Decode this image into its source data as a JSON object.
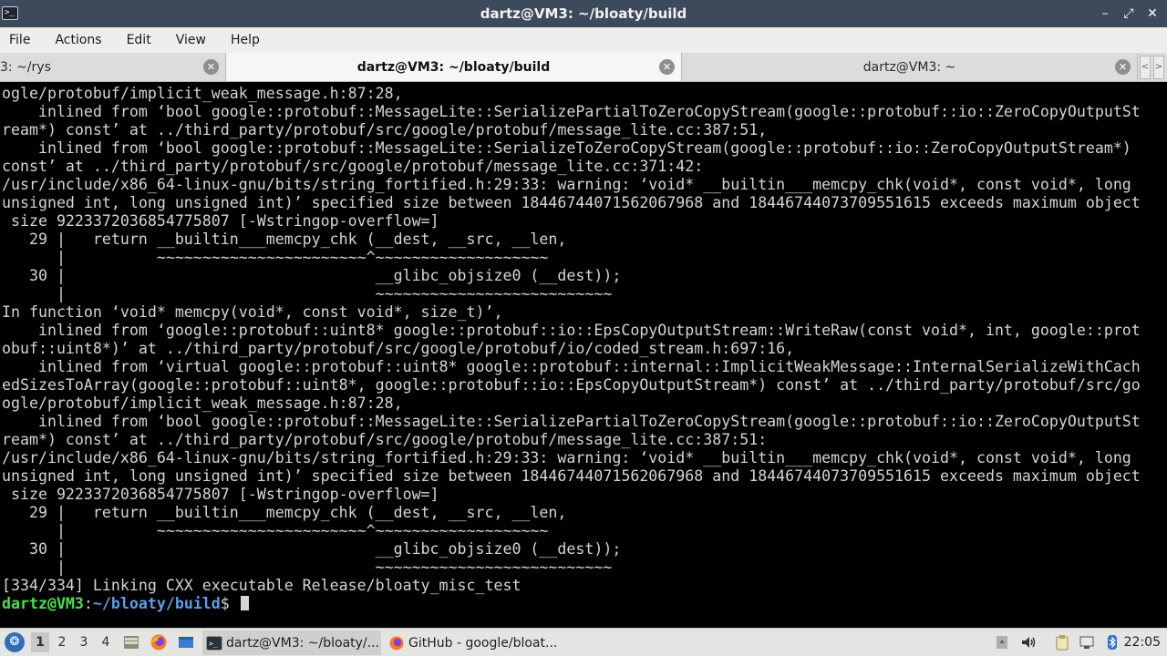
{
  "window": {
    "title": "dartz@VM3: ~/bloaty/build",
    "icon": "terminal-icon",
    "controls": {
      "minimize": "–",
      "maximize": "⤢",
      "close": "✕"
    }
  },
  "menu": {
    "items": [
      "File",
      "Actions",
      "Edit",
      "View",
      "Help"
    ]
  },
  "tabs": [
    {
      "label": "3: ~/rys",
      "close": "✕"
    },
    {
      "label": "dartz@VM3: ~/bloaty/build",
      "close": "✕",
      "active": true
    },
    {
      "label": "dartz@VM3: ~",
      "close": "✕"
    }
  ],
  "tab_scroll": {
    "left": "<",
    "right": ">"
  },
  "terminal": {
    "lines": [
      "ogle/protobuf/implicit_weak_message.h:87:28,",
      "    inlined from ‘bool google::protobuf::MessageLite::SerializePartialToZeroCopyStream(google::protobuf::io::ZeroCopyOutputSt",
      "ream*) const’ at ../third_party/protobuf/src/google/protobuf/message_lite.cc:387:51,",
      "    inlined from ‘bool google::protobuf::MessageLite::SerializeToZeroCopyStream(google::protobuf::io::ZeroCopyOutputStream*)",
      "const’ at ../third_party/protobuf/src/google/protobuf/message_lite.cc:371:42:",
      "/usr/include/x86_64-linux-gnu/bits/string_fortified.h:29:33: warning: ‘void* __builtin___memcpy_chk(void*, const void*, long",
      "unsigned int, long unsigned int)’ specified size between 18446744071562067968 and 18446744073709551615 exceeds maximum object",
      " size 9223372036854775807 [-Wstringop-overflow=]",
      "   29 |   return __builtin___memcpy_chk (__dest, __src, __len,",
      "      |          ~~~~~~~~~~~~~~~~~~~~~~~^~~~~~~~~~~~~~~~~~~~",
      "   30 |                                  __glibc_objsize0 (__dest));",
      "      |                                  ~~~~~~~~~~~~~~~~~~~~~~~~~~",
      "In function ‘void* memcpy(void*, const void*, size_t)’,",
      "    inlined from ‘google::protobuf::uint8* google::protobuf::io::EpsCopyOutputStream::WriteRaw(const void*, int, google::prot",
      "obuf::uint8*)’ at ../third_party/protobuf/src/google/protobuf/io/coded_stream.h:697:16,",
      "    inlined from ‘virtual google::protobuf::uint8* google::protobuf::internal::ImplicitWeakMessage::InternalSerializeWithCach",
      "edSizesToArray(google::protobuf::uint8*, google::protobuf::io::EpsCopyOutputStream*) const’ at ../third_party/protobuf/src/go",
      "ogle/protobuf/implicit_weak_message.h:87:28,",
      "    inlined from ‘bool google::protobuf::MessageLite::SerializePartialToZeroCopyStream(google::protobuf::io::ZeroCopyOutputSt",
      "ream*) const’ at ../third_party/protobuf/src/google/protobuf/message_lite.cc:387:51:",
      "/usr/include/x86_64-linux-gnu/bits/string_fortified.h:29:33: warning: ‘void* __builtin___memcpy_chk(void*, const void*, long",
      "unsigned int, long unsigned int)’ specified size between 18446744071562067968 and 18446744073709551615 exceeds maximum object",
      " size 9223372036854775807 [-Wstringop-overflow=]",
      "   29 |   return __builtin___memcpy_chk (__dest, __src, __len,",
      "      |          ~~~~~~~~~~~~~~~~~~~~~~~^~~~~~~~~~~~~~~~~~~~",
      "   30 |                                  __glibc_objsize0 (__dest));",
      "      |                                  ~~~~~~~~~~~~~~~~~~~~~~~~~~",
      "[334/334] Linking CXX executable Release/bloaty_misc_test"
    ],
    "prompt": {
      "user": "dartz@VM3",
      "sep": ":",
      "path": "~/bloaty/build",
      "symbol": "$ "
    },
    "colors": {
      "fg": "#d3d7cf",
      "bg": "#000000",
      "user": "#4ae04a",
      "path": "#5c9ee8"
    }
  },
  "taskbar": {
    "start_icon": "lxqt-start-icon",
    "desktops": [
      "1",
      "2",
      "3",
      "4"
    ],
    "launchers": [
      "file-manager-icon",
      "firefox-icon",
      "show-desktop-icon"
    ],
    "tasks": [
      {
        "label": "dartz@VM3: ~/bloaty/...",
        "icon": "terminal-icon",
        "active": true
      },
      {
        "label": "GitHub - google/bloat...",
        "icon": "firefox-icon",
        "active": false
      }
    ],
    "tray": [
      "storage-icon",
      "volume-icon",
      "clipboard-icon",
      "network-icon",
      "bluetooth-icon"
    ],
    "clock": "22:05"
  }
}
